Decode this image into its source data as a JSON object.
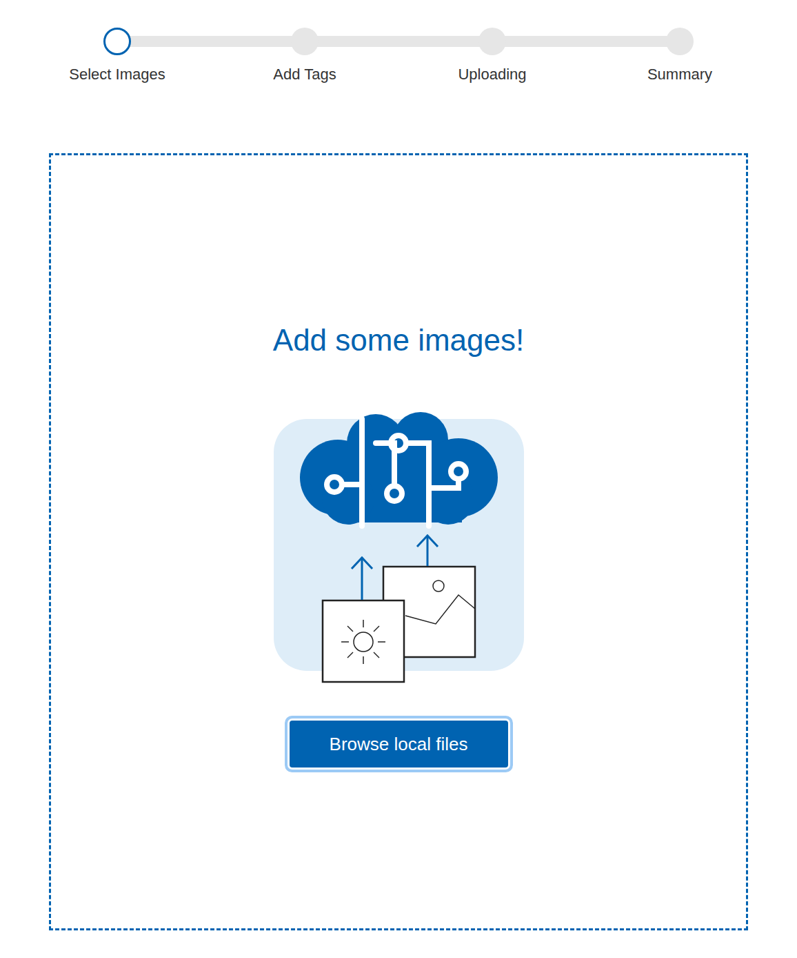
{
  "steps": [
    {
      "label": "Select Images",
      "selected": true
    },
    {
      "label": "Add Tags",
      "selected": false
    },
    {
      "label": "Uploading",
      "selected": false
    },
    {
      "label": "Summary",
      "selected": false
    }
  ],
  "heading": "Add some images!",
  "button": "Browse local files"
}
